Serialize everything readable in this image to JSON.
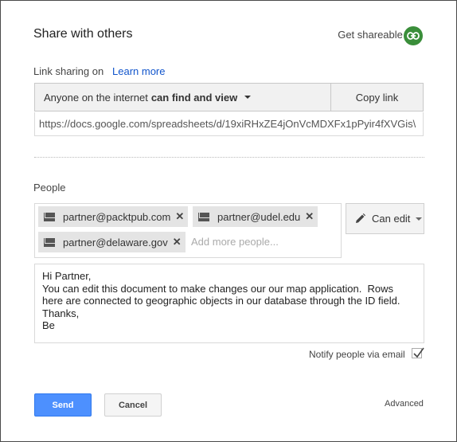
{
  "dialog": {
    "title": "Share with others",
    "get_shareable_link": "Get shareable link",
    "link_icon": "link-icon",
    "link_icon_color": "#3a8e3a"
  },
  "link_sharing": {
    "label": "Link sharing on",
    "learn_more": "Learn more",
    "access_prefix": "Anyone on the internet",
    "access_bold": "can find and view",
    "copy_link": "Copy link",
    "url": "https://docs.google.com/spreadsheets/d/19xiRHxZE4jOnVcMDXFx1pPyir4fXVGis\\"
  },
  "people": {
    "label": "People",
    "chips": [
      {
        "email": "partner@packtpub.com"
      },
      {
        "email": "partner@udel.edu"
      },
      {
        "email": "partner@delaware.gov"
      }
    ],
    "add_more_placeholder": "Add more people...",
    "permission": "Can edit",
    "permission_icon": "pencil-icon"
  },
  "message": {
    "text": "Hi Partner,\nYou can edit this document to make changes our our map application.  Rows here are connected to geographic objects in our database through the ID field.\nThanks,\nBe"
  },
  "notify": {
    "label": "Notify people via email",
    "checked": true
  },
  "actions": {
    "send": "Send",
    "cancel": "Cancel",
    "advanced": "Advanced",
    "send_color": "#4d90fe"
  }
}
